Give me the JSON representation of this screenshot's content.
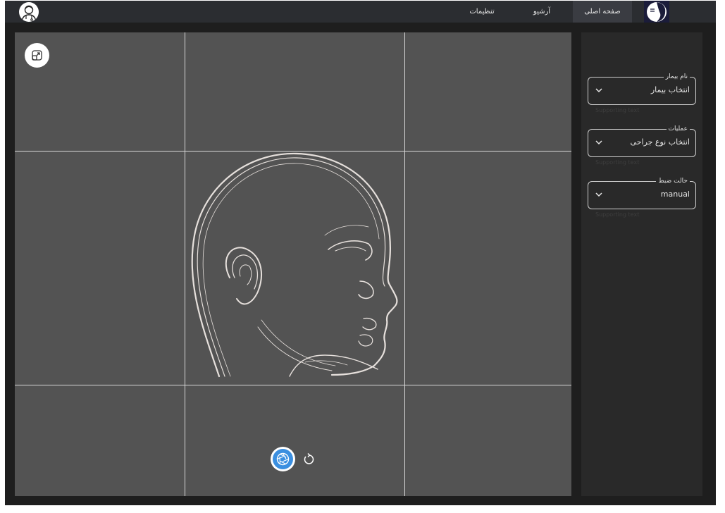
{
  "header": {
    "nav_items": [
      {
        "label": "صفحه اصلی",
        "active": true
      },
      {
        "label": "آرشیو",
        "active": false
      },
      {
        "label": "تنظیمات",
        "active": false
      }
    ]
  },
  "side_panel": {
    "fields": [
      {
        "label": "نام بیمار",
        "value": "انتخاب بیمار",
        "supporting_text": "Supporting text"
      },
      {
        "label": "عملیات",
        "value": "انتخاب نوع جراحی",
        "supporting_text": "Supporting text"
      },
      {
        "label": "حالت ضبط",
        "value": "manual",
        "supporting_text": "Supporting text"
      }
    ]
  },
  "icons": {
    "user_avatar": "doctor-avatar-icon",
    "logo": "app-logo-icon",
    "expand": "expand-icon",
    "shutter": "camera-shutter-icon",
    "rotate": "rotate-icon",
    "chevron": "chevron-down-icon"
  },
  "colors": {
    "background": "#1e1e1e",
    "topbar": "#2b2d31",
    "camera_view": "#535353",
    "side_panel": "#292929",
    "shutter_accent": "#3b8fe0"
  }
}
